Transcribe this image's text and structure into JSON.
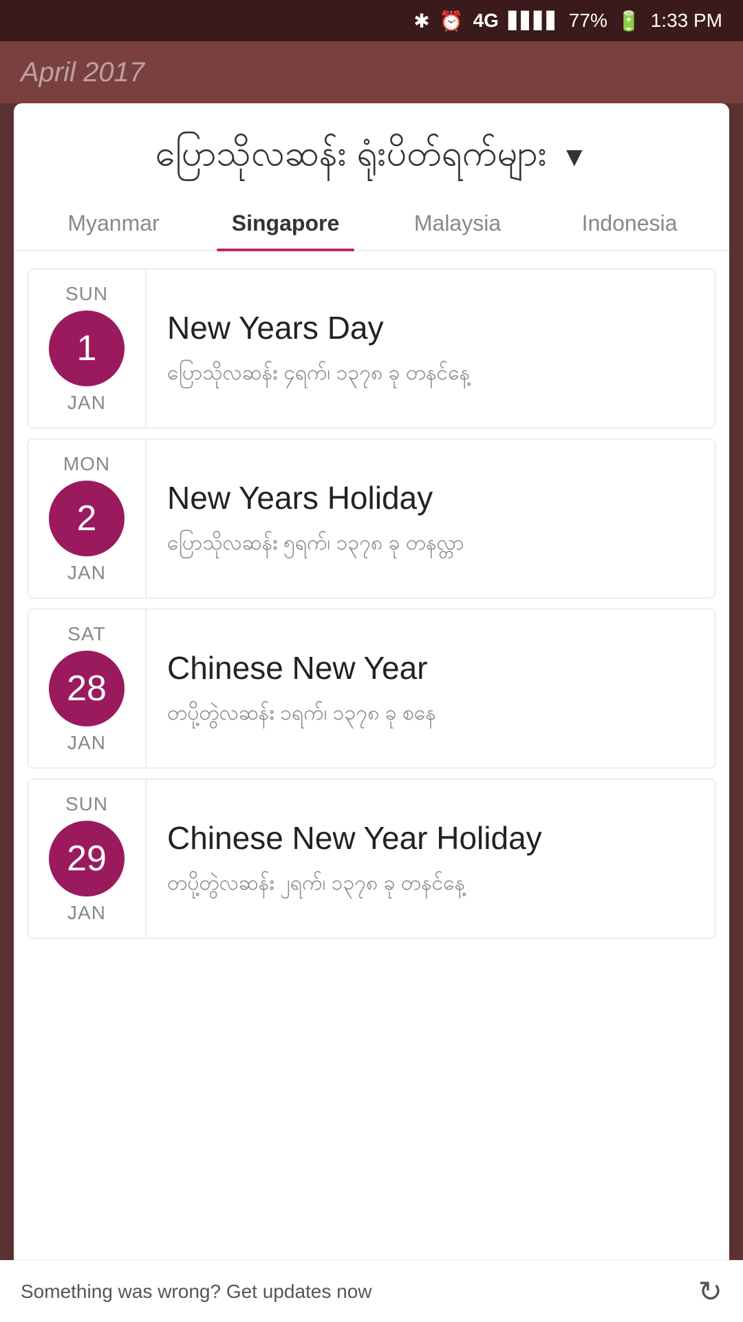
{
  "statusBar": {
    "battery": "77%",
    "time": "1:33 PM",
    "network": "4G"
  },
  "header": {
    "title": "ပြောသိုလဆန်း ရုံးပိတ်ရက်များ",
    "dropdownIcon": "▼",
    "bgTitleText": "April 2017"
  },
  "tabs": [
    {
      "id": "myanmar",
      "label": "Myanmar",
      "active": false
    },
    {
      "id": "singapore",
      "label": "Singapore",
      "active": true
    },
    {
      "id": "malaysia",
      "label": "Malaysia",
      "active": false
    },
    {
      "id": "indonesia",
      "label": "Indonesia",
      "active": false
    }
  ],
  "holidays": [
    {
      "id": 1,
      "dayName": "SUN",
      "dateNum": "1",
      "monthName": "JAN",
      "holidayName": "New Years Day",
      "myanmarDesc": "ပြောသိုလဆန်း ၄ရက်၊ ၁၃၇၈ ခု တနင်နေ့"
    },
    {
      "id": 2,
      "dayName": "MON",
      "dateNum": "2",
      "monthName": "JAN",
      "holidayName": "New Years Holiday",
      "myanmarDesc": "ပြောသိုလဆန်း ၅ရက်၊ ၁၃၇၈ ခု တနလ္တာ"
    },
    {
      "id": 3,
      "dayName": "SAT",
      "dateNum": "28",
      "monthName": "JAN",
      "holidayName": "Chinese New Year",
      "myanmarDesc": "တပို့တွဲလဆန်း ၁ရက်၊ ၁၃၇၈ ခု စနေ"
    },
    {
      "id": 4,
      "dayName": "SUN",
      "dateNum": "29",
      "monthName": "JAN",
      "holidayName": "Chinese New Year Holiday",
      "myanmarDesc": "တပို့တွဲလဆန်း ၂ရက်၊ ၁၃၇၈ ခု တနင်နေ့"
    }
  ],
  "bottomBar": {
    "message": "Something was wrong? Get updates now",
    "refreshIconLabel": "↻"
  }
}
